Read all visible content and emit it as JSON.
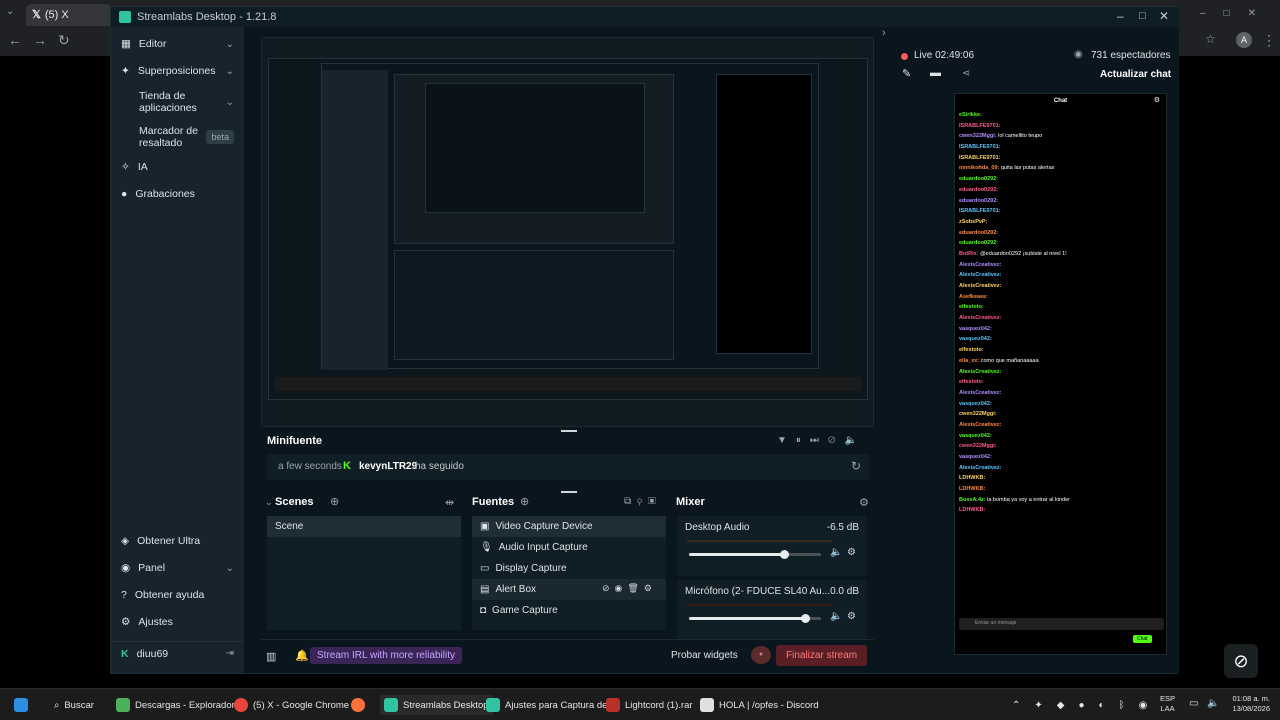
{
  "browser": {
    "tab_title": "(5) X"
  },
  "app": {
    "title": "Streamlabs Desktop - 1.21.8",
    "sidebar": {
      "items": [
        {
          "label": "Editor"
        },
        {
          "label": "Superposiciones"
        },
        {
          "label": "Tienda de aplicaciones"
        },
        {
          "label": "Marcador de resaltado",
          "badge": "beta"
        },
        {
          "label": "IA"
        },
        {
          "label": "Grabaciones"
        }
      ],
      "bottom_items": [
        {
          "label": "Obtener Ultra"
        },
        {
          "label": "Panel"
        },
        {
          "label": "Obtener ayuda"
        },
        {
          "label": "Ajustes"
        }
      ],
      "user": "diuu69"
    },
    "minifeed": {
      "title": "Minifuente",
      "event_time": "a few seconds",
      "event_user": "kevynLTR29",
      "event_action": "ha seguido"
    },
    "scenes": {
      "title": "Scenes",
      "items": [
        "Scene"
      ]
    },
    "sources": {
      "title": "Fuentes",
      "items": [
        "Video Capture Device",
        "Audio Input Capture",
        "Display Capture",
        "Alert Box",
        "Game Capture"
      ]
    },
    "mixer": {
      "title": "Mixer",
      "channels": [
        {
          "name": "Desktop Audio",
          "level": "-6.5 dB",
          "volume": 0.72
        },
        {
          "name": "Micrófono (2- FDUCE SL40 Au...",
          "level": "0.0 dB",
          "volume": 0.88
        }
      ]
    },
    "footer": {
      "irl_promo": "Stream IRL with more reliability",
      "test_widgets": "Probar widgets",
      "end_stream": "Finalizar stream"
    },
    "stream": {
      "live_label": "Live 02:49:06",
      "viewers": "731 espectadores",
      "refresh_chat": "Actualizar chat"
    },
    "chat": {
      "header": "Chat",
      "input_placeholder": "Enviar un mensaje",
      "send_label": "Chat",
      "lines": [
        "eSirikke:",
        "ISRABLFE9701:",
        "cwen322Mggi: lol camellito teupo",
        "ISRABLFE9701:",
        "ISRABLFE9701:",
        "ninnikohda_09: quita las putas alertas",
        "eduardoo0292:",
        "eduardoo0292:",
        "eduardoo0292:",
        "ISRABLFE9701:",
        "zSobsPvP:",
        "eduardoo0292:",
        "eduardoo0292:",
        "BotRix: @eduardoo0292 ¡subiste al nivel 1!",
        "AlexisCreativez:",
        "AlexisCreativez:",
        "AlexisCreativez:",
        "Asefkeaee:",
        "elfestoto:",
        "AlexisCreativez:",
        "vasquez042:",
        "vasquez042:",
        "elfestoto:",
        "ella_xx: como que mañanaaaaa",
        "AlexisCreativez:",
        "elfestoto:",
        "AlexisCreativez:",
        "vasquez042:",
        "cwen322Mggi:",
        "AlexisCreativez:",
        "vasquez042:",
        "cwen322Mggi:",
        "vasquez042:",
        "AlexisCreativez:",
        "LDHWKB:",
        "LDHWKB:",
        "BossA.4z: la bomba ya voy a entrar al kinder",
        "LDHWKB:"
      ]
    }
  },
  "taskbar": {
    "search": "Buscar",
    "items": [
      "Descargas - Explorador",
      "(5) X - Google Chrome",
      "Streamlabs Desktop",
      "Ajustes para Captura de",
      "Lightcord (1).rar",
      "HOLA | /opfes - Discord"
    ],
    "lang": "ESP",
    "region": "LAA",
    "time": "01:08 a. m.",
    "date": "13/08/2026"
  }
}
